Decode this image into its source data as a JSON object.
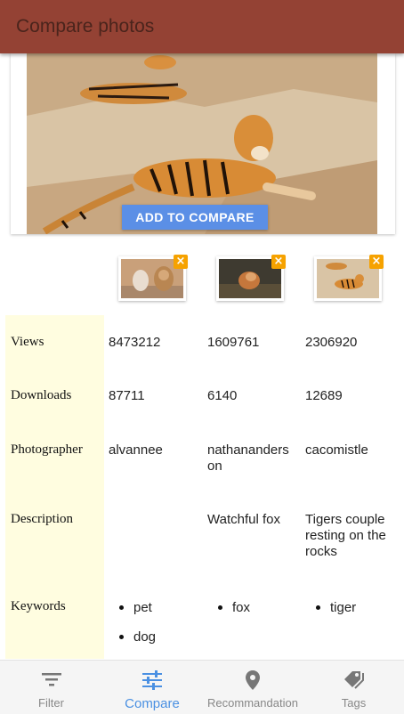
{
  "appbar": {
    "title": "Compare photos"
  },
  "hero": {
    "add_button": "ADD TO COMPARE"
  },
  "rows": {
    "views": "Views",
    "downloads": "Downloads",
    "photographer": "Photographer",
    "description": "Description",
    "keywords": "Keywords"
  },
  "photos": [
    {
      "views": "8473212",
      "downloads": "87711",
      "photographer": "alvannee",
      "description": "",
      "keywords": [
        "pet",
        "dog"
      ]
    },
    {
      "views": "1609761",
      "downloads": "6140",
      "photographer": "nathananders on",
      "description": "Watchful fox",
      "keywords": [
        "fox"
      ]
    },
    {
      "views": "2306920",
      "downloads": "12689",
      "photographer": "cacomistle",
      "description": "Tigers couple resting on the rocks",
      "keywords": [
        "tiger"
      ]
    }
  ],
  "remove_icon": "×",
  "nav": [
    {
      "label": "Filter",
      "icon": "filter-icon"
    },
    {
      "label": "Compare",
      "icon": "sliders-icon",
      "active": true
    },
    {
      "label": "Recommandation",
      "icon": "location-pin-icon"
    },
    {
      "label": "Tags",
      "icon": "tags-icon"
    }
  ],
  "colors": {
    "appbar": "#944234",
    "accent": "#4a90e2",
    "button": "#5b8fe6",
    "remove_badge": "#f6a200",
    "label_column": "#fffde0"
  }
}
